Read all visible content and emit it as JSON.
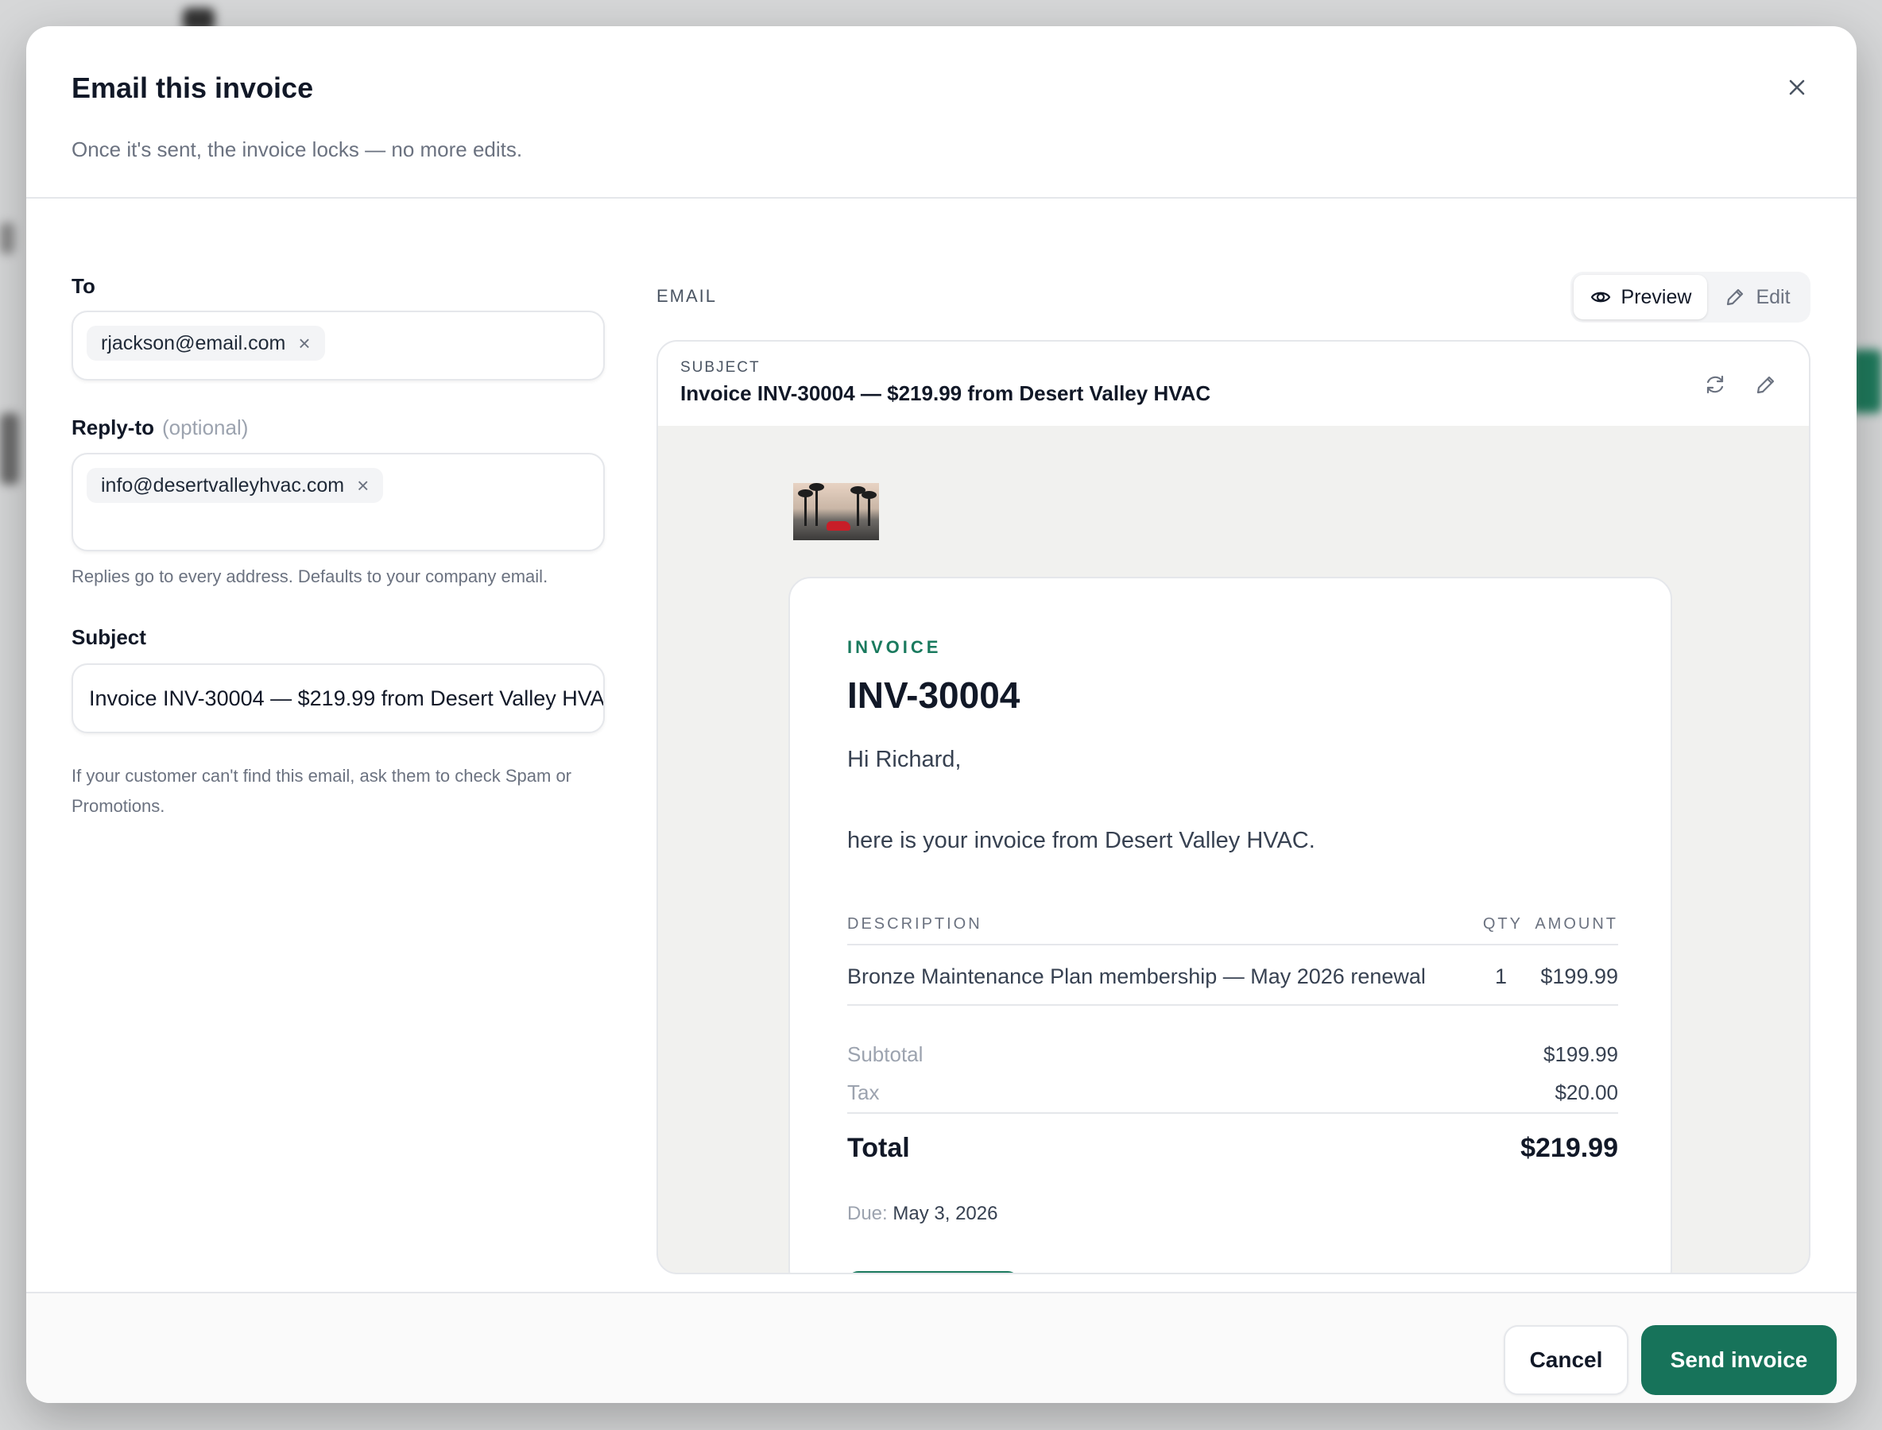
{
  "dialog": {
    "title": "Email this invoice",
    "subtitle": "Once it's sent, the invoice locks — no more edits."
  },
  "to": {
    "label": "To",
    "chip": "rjackson@email.com",
    "remove": "×"
  },
  "reply_to": {
    "label": "Reply-to",
    "optional": "(optional)",
    "chip": "info@desertvalleyhvac.com",
    "remove": "×",
    "help": "Replies go to every address. Defaults to your company email."
  },
  "subject": {
    "label": "Subject",
    "value": "Invoice INV-30004 — $219.99 from Desert Valley HVAC",
    "help": "If your customer can't find this email, ask them to check Spam or Promotions."
  },
  "email_panel": {
    "label": "EMAIL",
    "preview_label": "Preview",
    "edit_label": "Edit",
    "active_mode": "Preview",
    "subject_caption": "SUBJECT",
    "subject_value": "Invoice INV-30004 — $219.99 from Desert Valley HVAC"
  },
  "invoice": {
    "caption": "INVOICE",
    "number": "INV-30004",
    "greeting": "Hi Richard,",
    "intro": "here is your invoice from Desert Valley HVAC.",
    "columns": {
      "description": "DESCRIPTION",
      "qty": "QTY",
      "amount": "AMOUNT"
    },
    "items": [
      {
        "description": "Bronze Maintenance Plan membership — May 2026 renewal",
        "qty": "1",
        "amount": "$199.99"
      }
    ],
    "subtotal_label": "Subtotal",
    "subtotal": "$199.99",
    "tax_label": "Tax",
    "tax": "$20.00",
    "total_label": "Total",
    "total": "$219.99",
    "due_label": "Due:",
    "due_date": "May 3, 2026"
  },
  "footer": {
    "cancel_label": "Cancel",
    "send_label": "Send invoice"
  },
  "colors": {
    "accent": "#17735a",
    "invoice_caption": "#1a7a5e"
  },
  "icons": {
    "close": "close-icon",
    "preview": "eye-icon",
    "edit": "pencil-icon",
    "regenerate": "refresh-icon",
    "edit_subject": "pencil-icon"
  }
}
